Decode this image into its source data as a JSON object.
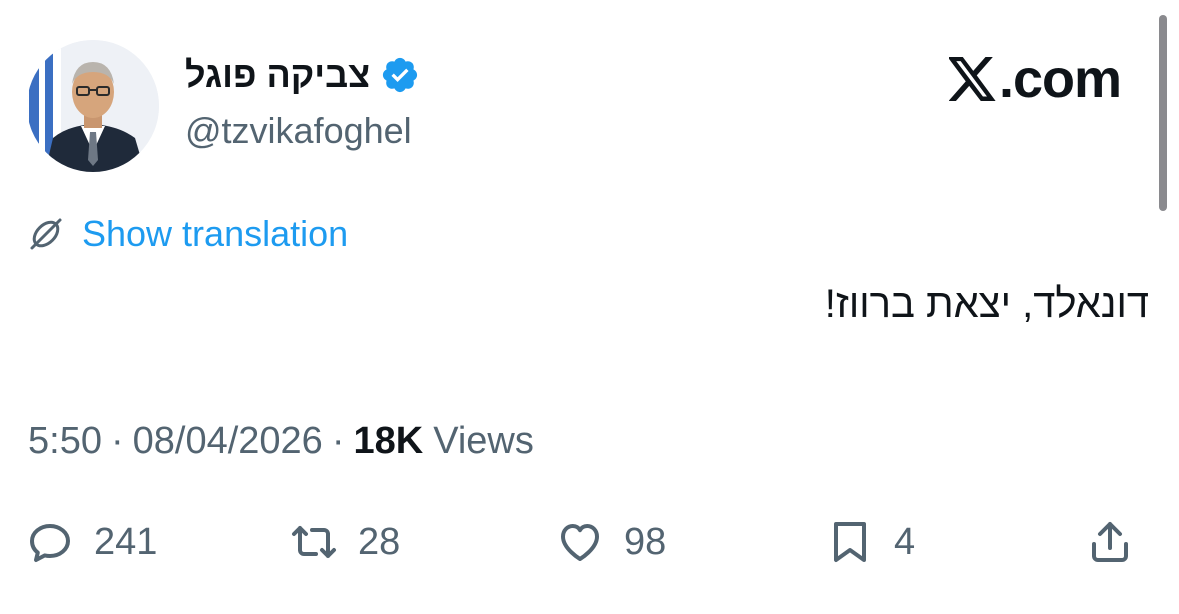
{
  "header": {
    "display_name": "צביקה פוגל",
    "handle": "@tzvikafoghel",
    "brand": ".com"
  },
  "icons": {
    "verified": "verified-badge-icon",
    "brand": "x-logo-icon",
    "translate": "globe-icon",
    "reply": "reply-icon",
    "repost": "repost-icon",
    "like": "heart-icon",
    "bookmark": "bookmark-icon",
    "share": "share-icon"
  },
  "translation": {
    "label": "Show translation"
  },
  "tweet": {
    "text": "דונאלד, יצאת ברווז!"
  },
  "meta": {
    "time": "5:50",
    "date": "08/04/2026",
    "views_count": "18K",
    "views_label": "Views"
  },
  "actions": {
    "replies": "241",
    "reposts": "28",
    "likes": "98",
    "bookmarks": "4"
  },
  "colors": {
    "accent": "#1d9bf0",
    "text": "#0f1419",
    "secondary": "#536471",
    "background": "#ffffff"
  }
}
